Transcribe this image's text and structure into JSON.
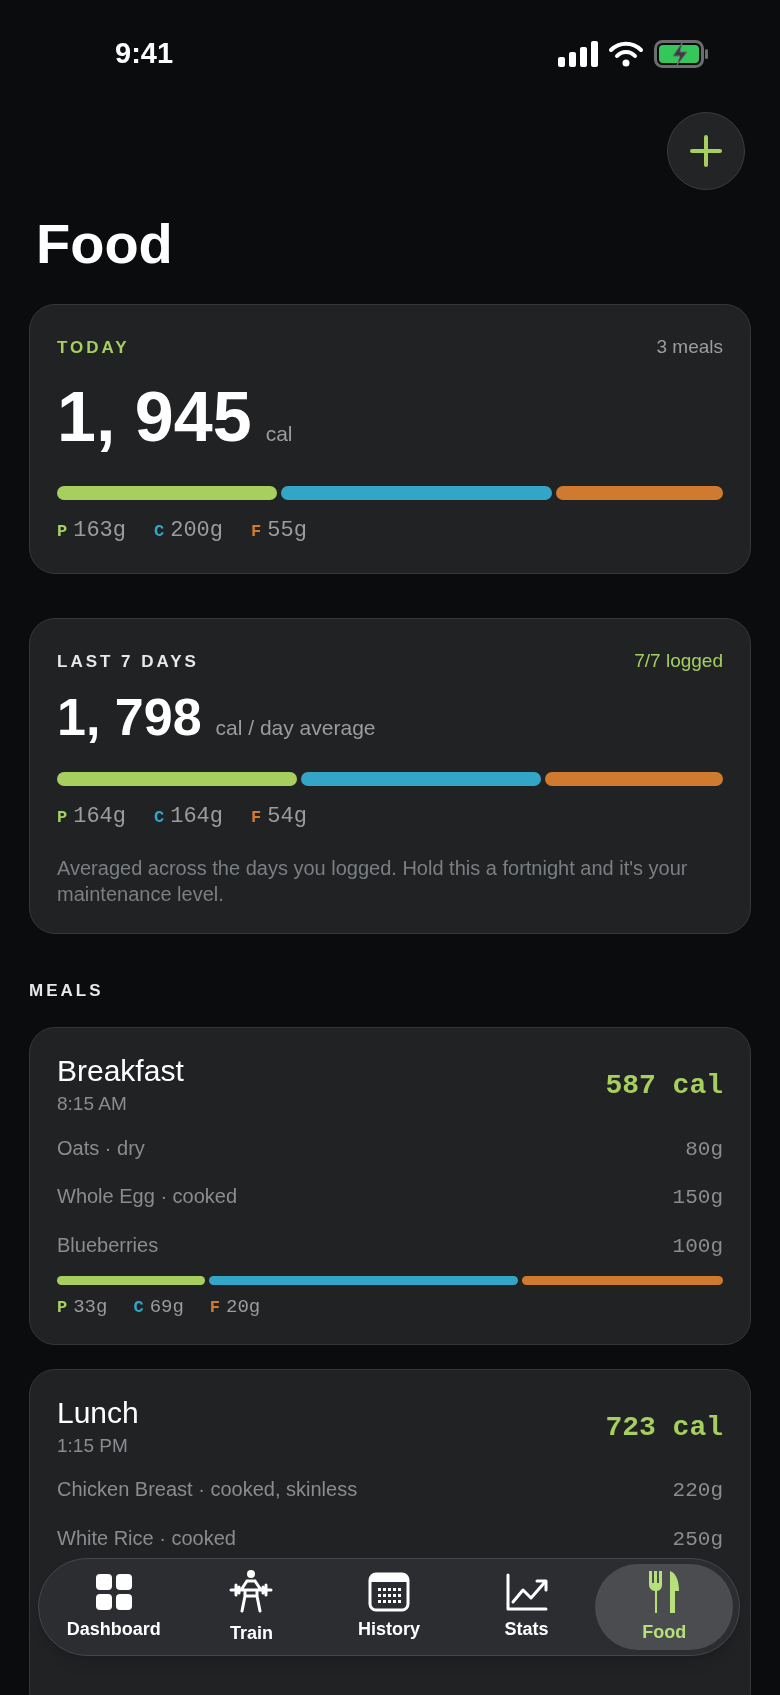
{
  "status_bar": {
    "time": "9:41"
  },
  "title": "Food",
  "today": {
    "label": "TODAY",
    "meta": "3 meals",
    "calories": "1, 945",
    "unit": "cal",
    "macros": [
      {
        "kind": "protein",
        "letter": "P",
        "value": "163g"
      },
      {
        "kind": "carbs",
        "letter": "C",
        "value": "200g"
      },
      {
        "kind": "fat",
        "letter": "F",
        "value": "55g"
      }
    ]
  },
  "week": {
    "label": "LAST 7 DAYS",
    "meta": "7/7 logged",
    "calories": "1, 798",
    "unit": "cal / day average",
    "macros": [
      {
        "kind": "protein",
        "letter": "P",
        "value": "164g"
      },
      {
        "kind": "carbs",
        "letter": "C",
        "value": "164g"
      },
      {
        "kind": "fat",
        "letter": "F",
        "value": "54g"
      }
    ],
    "note": "Averaged across the days you logged. Hold this a fortnight and it's your maintenance level."
  },
  "meals_heading": "MEALS",
  "meals": [
    {
      "name": "Breakfast",
      "time": "8:15 AM",
      "calories": "587 cal",
      "items": [
        {
          "name": "Oats · dry",
          "amount": "80g"
        },
        {
          "name": "Whole Egg · cooked",
          "amount": "150g"
        },
        {
          "name": "Blueberries",
          "amount": "100g"
        }
      ],
      "macros": [
        {
          "kind": "protein",
          "letter": "P",
          "value": "33g"
        },
        {
          "kind": "carbs",
          "letter": "C",
          "value": "69g"
        },
        {
          "kind": "fat",
          "letter": "F",
          "value": "20g"
        }
      ]
    },
    {
      "name": "Lunch",
      "time": "1:15 PM",
      "calories": "723 cal",
      "items": [
        {
          "name": "Chicken Breast · cooked, skinless",
          "amount": "220g"
        },
        {
          "name": "White Rice · cooked",
          "amount": "250g"
        }
      ]
    }
  ],
  "tabs": [
    {
      "kind": "dashboard",
      "label": "Dashboard",
      "selected": false
    },
    {
      "kind": "train",
      "label": "Train",
      "selected": false
    },
    {
      "kind": "history",
      "label": "History",
      "selected": false
    },
    {
      "kind": "stats",
      "label": "Stats",
      "selected": false
    },
    {
      "kind": "food",
      "label": "Food",
      "selected": true
    }
  ]
}
